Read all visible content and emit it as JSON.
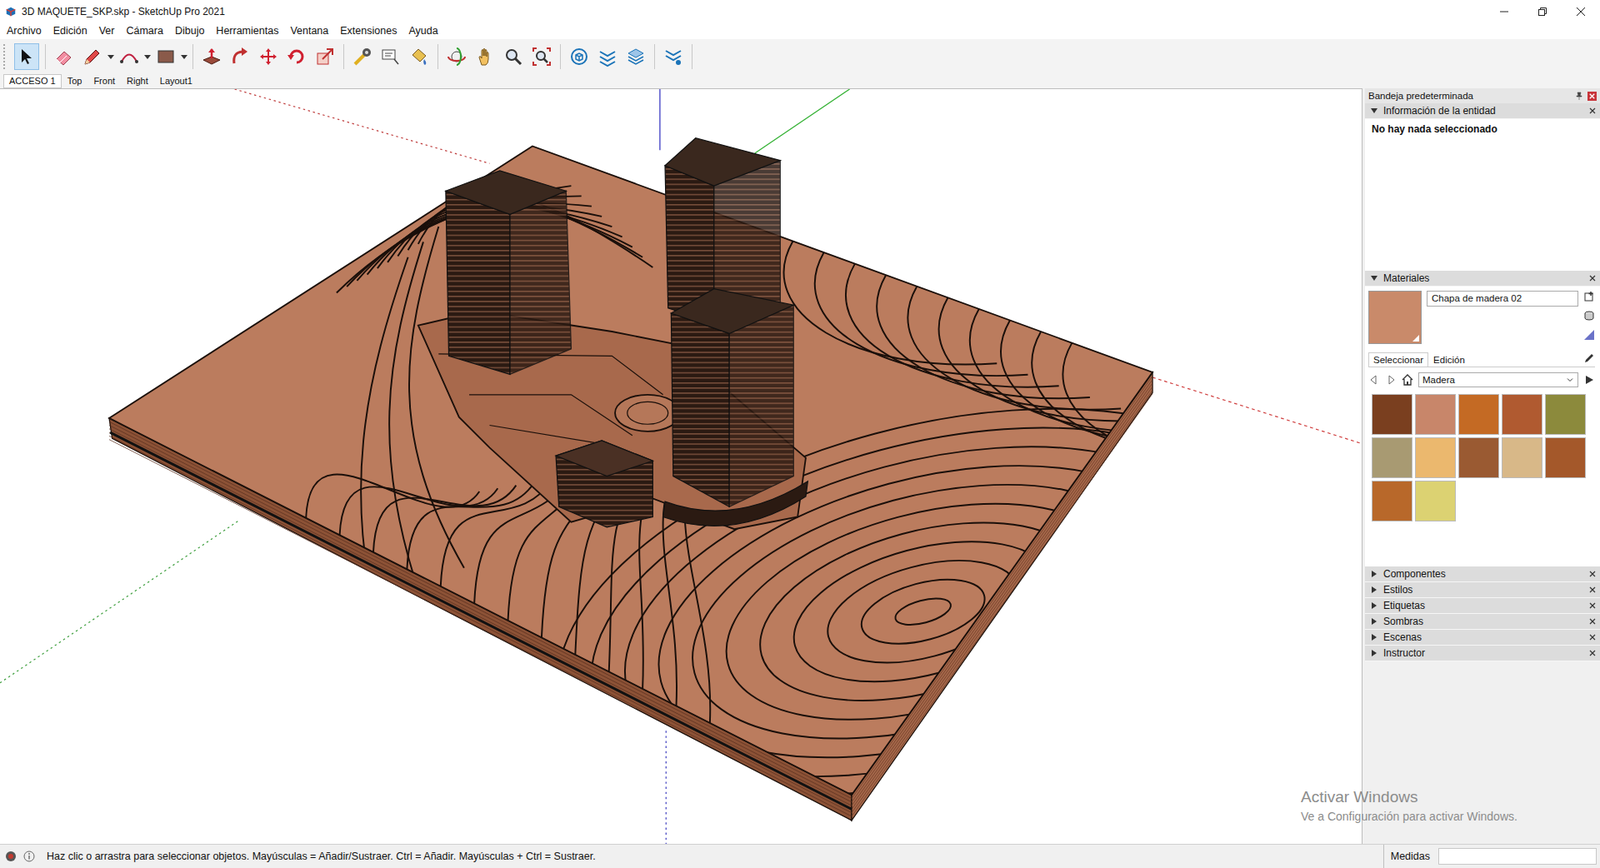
{
  "window": {
    "title": "3D MAQUETE_SKP.skp - SketchUp Pro 2021"
  },
  "menu": [
    "Archivo",
    "Edición",
    "Ver",
    "Cámara",
    "Dibujo",
    "Herramientas",
    "Ventana",
    "Extensiones",
    "Ayuda"
  ],
  "toolbar": [
    {
      "selected": true
    },
    {
      "selected": false
    },
    {
      "selected": false
    },
    {
      "selected": false
    },
    {
      "selected": false
    },
    {
      "selected": false
    },
    {
      "selected": false
    },
    {
      "selected": false
    },
    {
      "selected": false
    },
    {
      "selected": false
    },
    {
      "selected": false
    },
    {
      "selected": false
    },
    {
      "selected": false
    },
    {
      "selected": false
    },
    {
      "selected": false
    },
    {
      "selected": false
    },
    {
      "selected": false
    },
    {
      "selected": false
    },
    {
      "selected": false
    },
    {
      "selected": false
    },
    {
      "selected": false
    }
  ],
  "scenes": [
    {
      "label": "ACCESO 1",
      "selected": true
    },
    {
      "label": "Top",
      "selected": false
    },
    {
      "label": "Front",
      "selected": false
    },
    {
      "label": "Right",
      "selected": false
    },
    {
      "label": "Layout1",
      "selected": false
    }
  ],
  "tray": {
    "title": "Bandeja predeterminada",
    "entity_info": {
      "title": "Información de la entidad",
      "expanded": true,
      "message": "No hay nada seleccionado"
    },
    "materials": {
      "title": "Materiales",
      "expanded": true,
      "current": {
        "name": "Chapa de madera 02",
        "color": "#c98a6a"
      },
      "tabs": [
        {
          "label": "Seleccionar",
          "selected": true
        },
        {
          "label": "Edición",
          "selected": false
        }
      ],
      "library": "Madera",
      "swatches": [
        {
          "color": "#7a3f1f"
        },
        {
          "color": "#c8866a"
        },
        {
          "color": "#c46a24"
        },
        {
          "color": "#b05a30"
        },
        {
          "color": "#8c8a3c"
        },
        {
          "color": "#a89a72"
        },
        {
          "color": "#ebb86e"
        },
        {
          "color": "#9a5a32"
        },
        {
          "color": "#d8b888"
        },
        {
          "color": "#a4582a"
        },
        {
          "color": "#b8682a"
        },
        {
          "color": "#dcd272"
        }
      ]
    },
    "panels": [
      {
        "title": "Componentes",
        "expanded": false
      },
      {
        "title": "Estilos",
        "expanded": false
      },
      {
        "title": "Etiquetas",
        "expanded": false
      },
      {
        "title": "Sombras",
        "expanded": false
      },
      {
        "title": "Escenas",
        "expanded": false
      },
      {
        "title": "Instructor",
        "expanded": false
      }
    ]
  },
  "status_bar": {
    "hint": "Haz clic o arrastra para seleccionar objetos. Mayúsculas = Añadir/Sustraer. Ctrl = Añadir. Mayúsculas + Ctrl = Sustraer.",
    "measurements_label": "Medidas",
    "measurements_value": ""
  },
  "watermark": {
    "title": "Activar Windows",
    "subtitle": "Ve a Configuración para activar Windows."
  }
}
